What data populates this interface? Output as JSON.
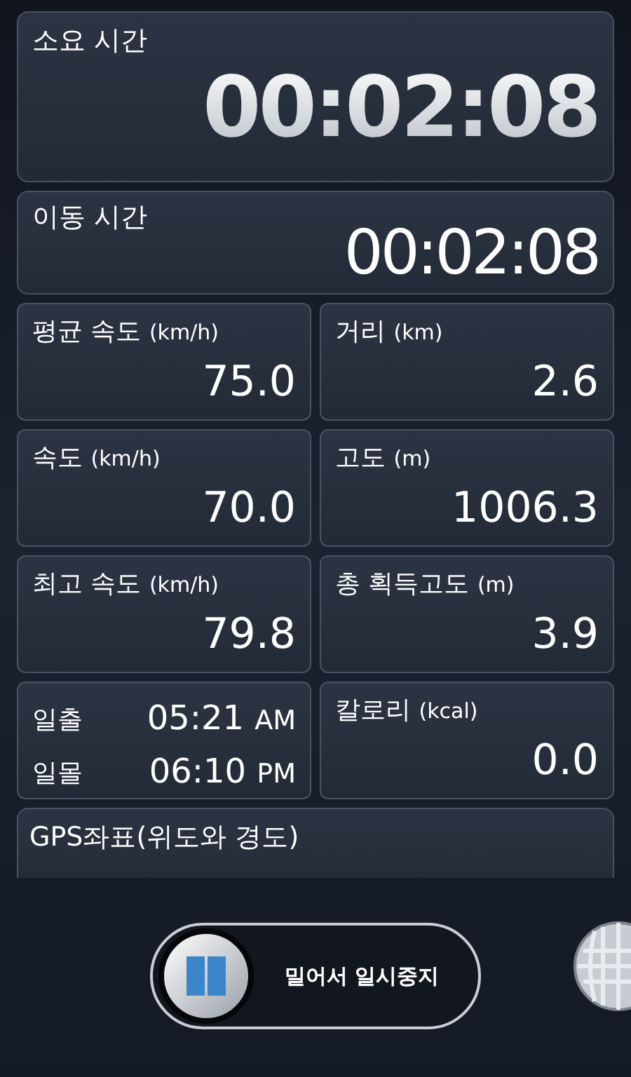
{
  "elapsed": {
    "label": "소요 시간",
    "value": "00:02:08"
  },
  "moving": {
    "label": "이동 시간",
    "value": "00:02:08"
  },
  "stats": [
    {
      "kind": "metric",
      "label": "평균 속도",
      "unit": "(km/h)",
      "value": "75.0"
    },
    {
      "kind": "metric",
      "label": "거리",
      "unit": "(km)",
      "value": "2.6"
    },
    {
      "kind": "metric",
      "label": "속도",
      "unit": "(km/h)",
      "value": "70.0"
    },
    {
      "kind": "metric",
      "label": "고도",
      "unit": "(m)",
      "value": "1006.3"
    },
    {
      "kind": "metric",
      "label": "최고 속도",
      "unit": "(km/h)",
      "value": "79.8"
    },
    {
      "kind": "metric",
      "label": "총 획득고도",
      "unit": "(m)",
      "value": "3.9"
    },
    {
      "kind": "sun",
      "rows": [
        {
          "label": "일출",
          "time": "05:21",
          "period": "AM"
        },
        {
          "label": "일몰",
          "time": "06:10",
          "period": "PM"
        }
      ]
    },
    {
      "kind": "metric",
      "label": "칼로리",
      "unit": "(kcal)",
      "value": "0.0"
    }
  ],
  "gps": {
    "label": "GPS좌표(위도와 경도)"
  },
  "slider": {
    "label": "밀어서 일시중지",
    "level": 0
  }
}
